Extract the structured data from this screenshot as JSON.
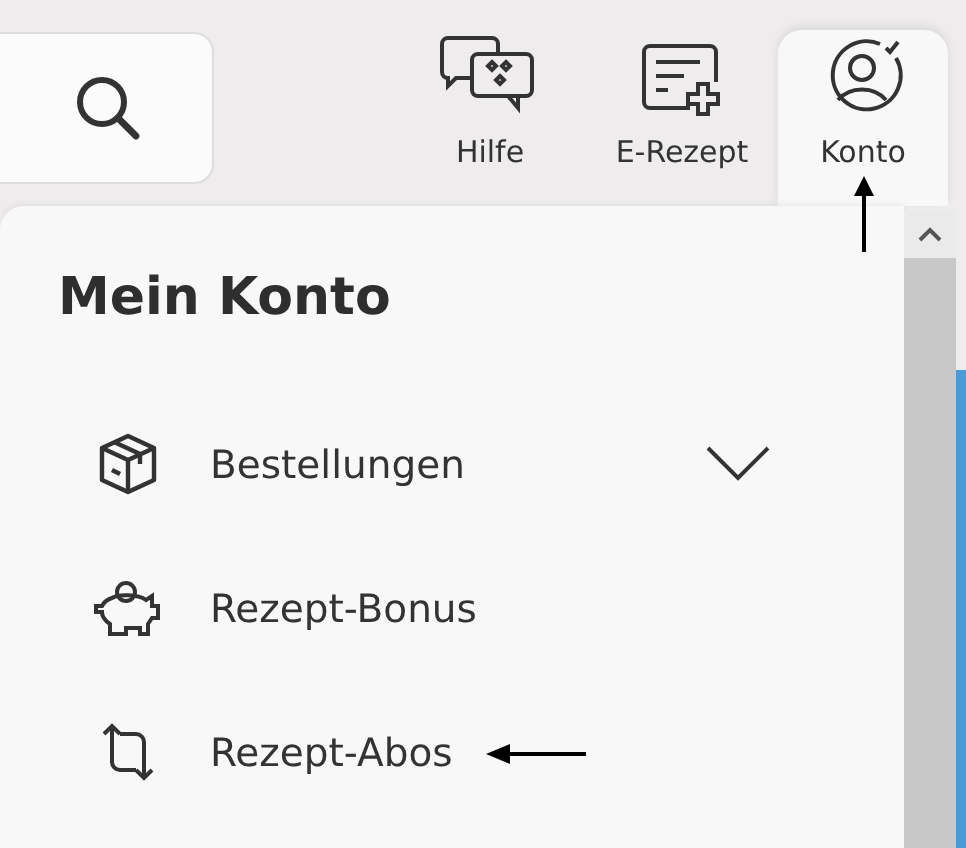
{
  "header": {
    "nav": [
      {
        "label": "Hilfe",
        "kind": "help",
        "selected": false
      },
      {
        "label": "E-Rezept",
        "kind": "prescription",
        "selected": false
      },
      {
        "label": "Konto",
        "kind": "account",
        "selected": true
      }
    ]
  },
  "account_menu": {
    "title": "Mein Konto",
    "items": [
      {
        "label": "Bestellungen",
        "kind": "orders",
        "expanded": false
      },
      {
        "label": "Rezept-Bonus",
        "kind": "bonus"
      },
      {
        "label": "Rezept-Abos",
        "kind": "subscriptions"
      }
    ]
  }
}
